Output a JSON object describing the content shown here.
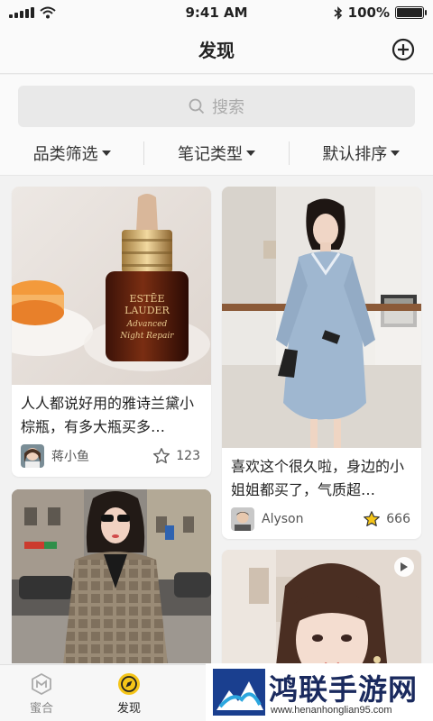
{
  "status_bar": {
    "time": "9:41 AM",
    "battery": "100%"
  },
  "nav": {
    "title": "发现"
  },
  "search": {
    "placeholder": "搜索"
  },
  "filters": [
    {
      "label": "品类筛选"
    },
    {
      "label": "笔记类型"
    },
    {
      "label": "默认排序"
    }
  ],
  "feed": {
    "cards": [
      {
        "title": "人人都说好用的雅诗兰黛小棕瓶，有多大瓶买多…",
        "author": "蒋小鱼",
        "likes": "123",
        "liked": false
      },
      {
        "title": "喜欢这个很久啦，身边的小姐姐都买了，气质超…",
        "author": "Alyson",
        "likes": "666",
        "liked": true
      },
      {
        "title": "",
        "author": "",
        "likes": ""
      },
      {
        "title": "",
        "author": "",
        "likes": ""
      }
    ],
    "product_label": [
      "ESTĒE",
      "LAUDER",
      "Advanced",
      "Night Repair"
    ]
  },
  "tabs": [
    {
      "label": "蜜合",
      "icon": "m-logo-icon"
    },
    {
      "label": "发现",
      "icon": "compass-icon",
      "active": true
    }
  ],
  "watermark": {
    "text": "鸿联手游网",
    "url": "www.henanhonglian95.com"
  },
  "colors": {
    "accent": "#f5c518",
    "text": "#222222",
    "muted": "#888888"
  }
}
